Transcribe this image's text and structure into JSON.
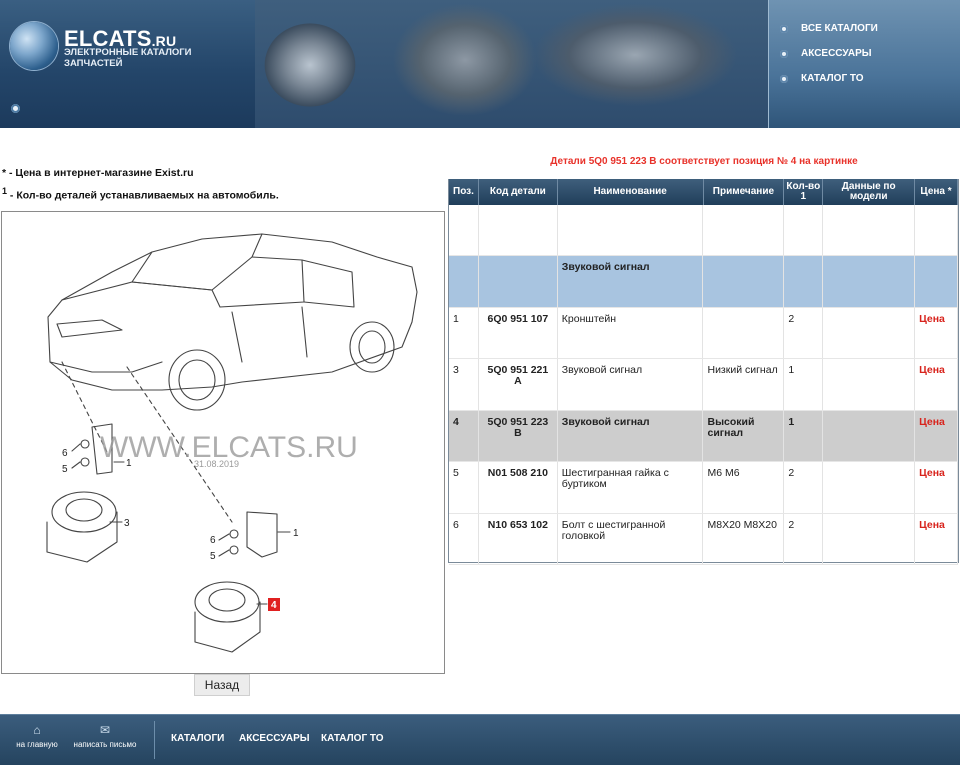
{
  "header": {
    "logo_title_main": "ELCATS",
    "logo_title_suffix": ".RU",
    "logo_subtitle": "ЭЛЕКТРОННЫЕ КАТАЛОГИ ЗАПЧАСТЕЙ",
    "nav": [
      "ВСЕ КАТАЛОГИ",
      "АКСЕССУАРЫ",
      "КАТАЛОГ ТО"
    ]
  },
  "notes": {
    "price_note": "* - Цена в интернет-магазине Exist.ru",
    "qty_note_sup": "1",
    "qty_note": " - Кол-во деталей устанавливаемых на автомобиль."
  },
  "diagram": {
    "watermark": "WWW.ELCATS.RU",
    "date": "31.08.2019",
    "callouts": [
      "6",
      "5",
      "1",
      "3",
      "6",
      "5",
      "1",
      "4"
    ]
  },
  "back_button": "Назад",
  "details": {
    "title": "Детали 5Q0 951 223 B соответствует позиция № 4 на картинке",
    "columns": [
      "Поз.",
      "Код детали",
      "Наименование",
      "Примечание",
      "Кол-во 1",
      "Данные по модели",
      "Цена *"
    ],
    "group_label": "Звуковой сигнал",
    "rows": [
      {
        "pos": "1",
        "code": "6Q0 951 107",
        "name": "Кронштейн",
        "note": "",
        "qty": "2",
        "model": "",
        "price": "Цена",
        "selected": false
      },
      {
        "pos": "3",
        "code": "5Q0 951 221 A",
        "name": "Звуковой сигнал",
        "note": "Низкий сигнал",
        "qty": "1",
        "model": "",
        "price": "Цена",
        "selected": false
      },
      {
        "pos": "4",
        "code": "5Q0 951 223 B",
        "name": "Звуковой сигнал",
        "note": "Высокий сигнал",
        "qty": "1",
        "model": "",
        "price": "Цена",
        "selected": true
      },
      {
        "pos": "5",
        "code": "N01 508 210",
        "name": "Шестигранная гайка с буртиком",
        "note": "M6 M6",
        "qty": "2",
        "model": "",
        "price": "Цена",
        "selected": false
      },
      {
        "pos": "6",
        "code": "N10 653 102",
        "name": "Болт с шестигранной головкой",
        "note": "M8X20 M8X20",
        "qty": "2",
        "model": "",
        "price": "Цена",
        "selected": false
      }
    ]
  },
  "footer": {
    "home": "на главную",
    "mail": "написать письмо",
    "links": [
      "КАТАЛОГИ",
      "АКСЕССУАРЫ",
      "КАТАЛОГ ТО"
    ]
  },
  "colors": {
    "accent_red": "#e8322a",
    "header_blue": "#24466a",
    "group_row": "#a8c4e0",
    "selected_row": "#cdcdcd"
  }
}
